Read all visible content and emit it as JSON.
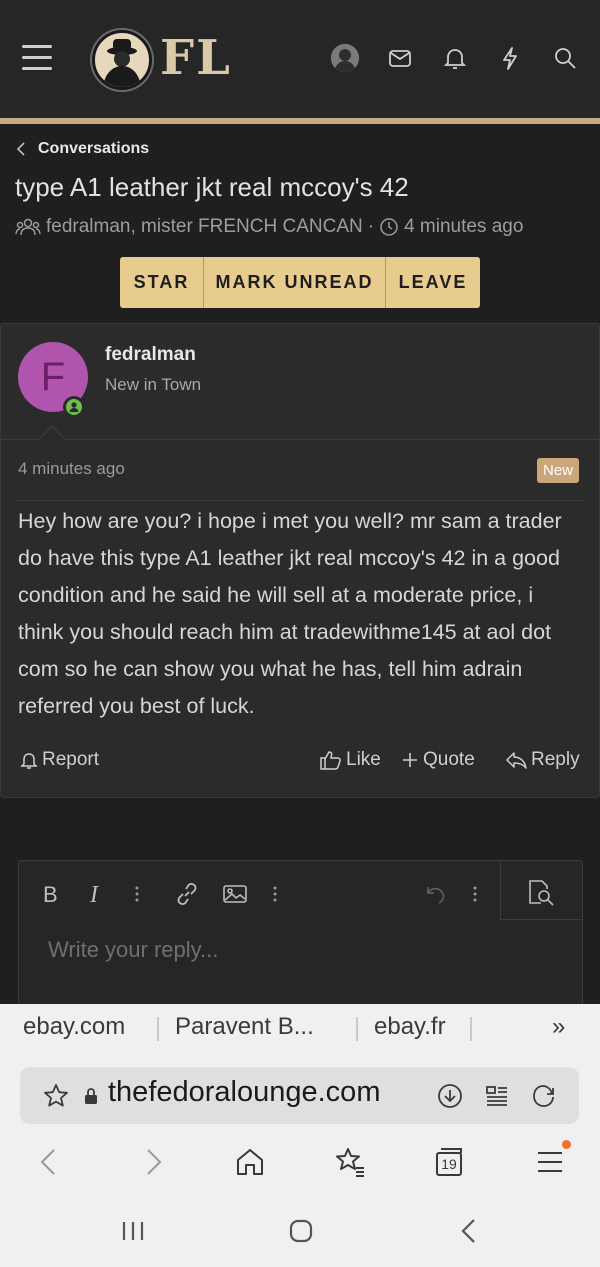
{
  "header": {
    "logo_text": "FL",
    "icons": [
      "menu-icon",
      "user-avatar",
      "mail-icon",
      "bell-icon",
      "lightning-icon",
      "search-icon"
    ]
  },
  "conversation": {
    "breadcrumb": "Conversations",
    "title": "type A1 leather jkt real mccoy's 42",
    "participants": "fedralman, mister FRENCH CANCAN",
    "separator": "·",
    "time_ago": "4 minutes ago",
    "buttons": {
      "star": "STAR",
      "mark_unread": "MARK UNREAD",
      "leave": "LEAVE"
    }
  },
  "message": {
    "author_initial": "F",
    "author": "fedralman",
    "author_title": "New in Town",
    "posted": "4 minutes ago",
    "badge": "New",
    "body": "Hey how are you? i hope i met you well? mr sam a trader do have this type A1 leather jkt real mccoy's 42 in a good condition and he said he will sell at a moderate price, i think you should reach him at tradewithme145 at aol dot com so he can show you what he has, tell him adrain referred you best of luck.",
    "actions": {
      "report": "Report",
      "like": "Like",
      "quote": "Quote",
      "reply": "Reply"
    }
  },
  "editor": {
    "placeholder": "Write your reply..."
  },
  "browser": {
    "bookmarks": [
      "ebay.com",
      "Paravent B...",
      "ebay.fr"
    ],
    "more": "»",
    "url": "thefedoralounge.com",
    "tab_count": "19"
  },
  "colors": {
    "accent": "#e8cc8f",
    "strip": "#c9ab83",
    "avatar": "#b154ad",
    "online": "#6cc04a",
    "badge": "#c9a77a"
  }
}
